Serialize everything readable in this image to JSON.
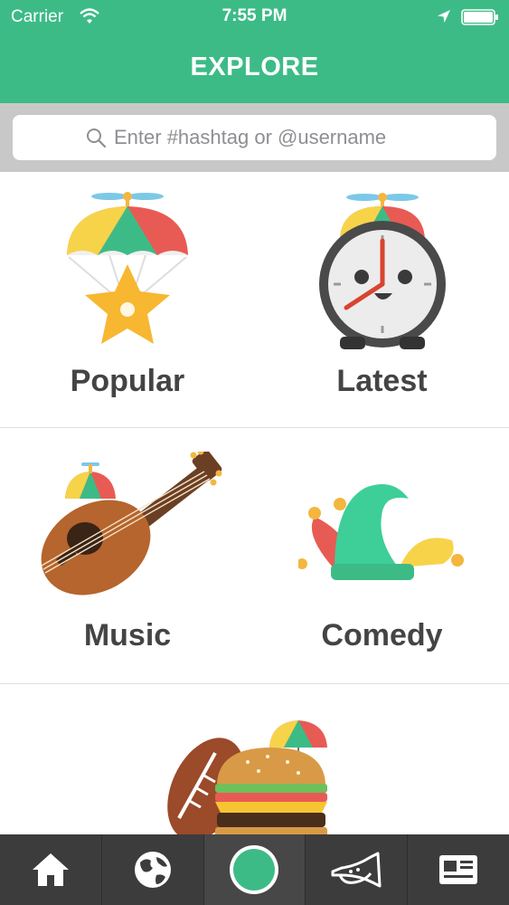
{
  "status_bar": {
    "carrier": "Carrier",
    "time": "7:55 PM"
  },
  "header": {
    "title": "EXPLORE"
  },
  "search": {
    "placeholder": "Enter #hashtag or @username",
    "value": ""
  },
  "categories": [
    {
      "label": "Popular",
      "icon": "parachute-star-icon"
    },
    {
      "label": "Latest",
      "icon": "alarm-clock-icon"
    },
    {
      "label": "Music",
      "icon": "guitar-icon"
    },
    {
      "label": "Comedy",
      "icon": "jester-hat-icon"
    },
    {
      "label": "",
      "icon": "football-burger-icon"
    }
  ],
  "tabbar": {
    "items": [
      "home-icon",
      "globe-icon",
      "record-icon",
      "horn-icon",
      "news-icon"
    ]
  },
  "colors": {
    "brand": "#3dbb87",
    "tabbar": "#3c3c3c",
    "label": "#444444"
  }
}
